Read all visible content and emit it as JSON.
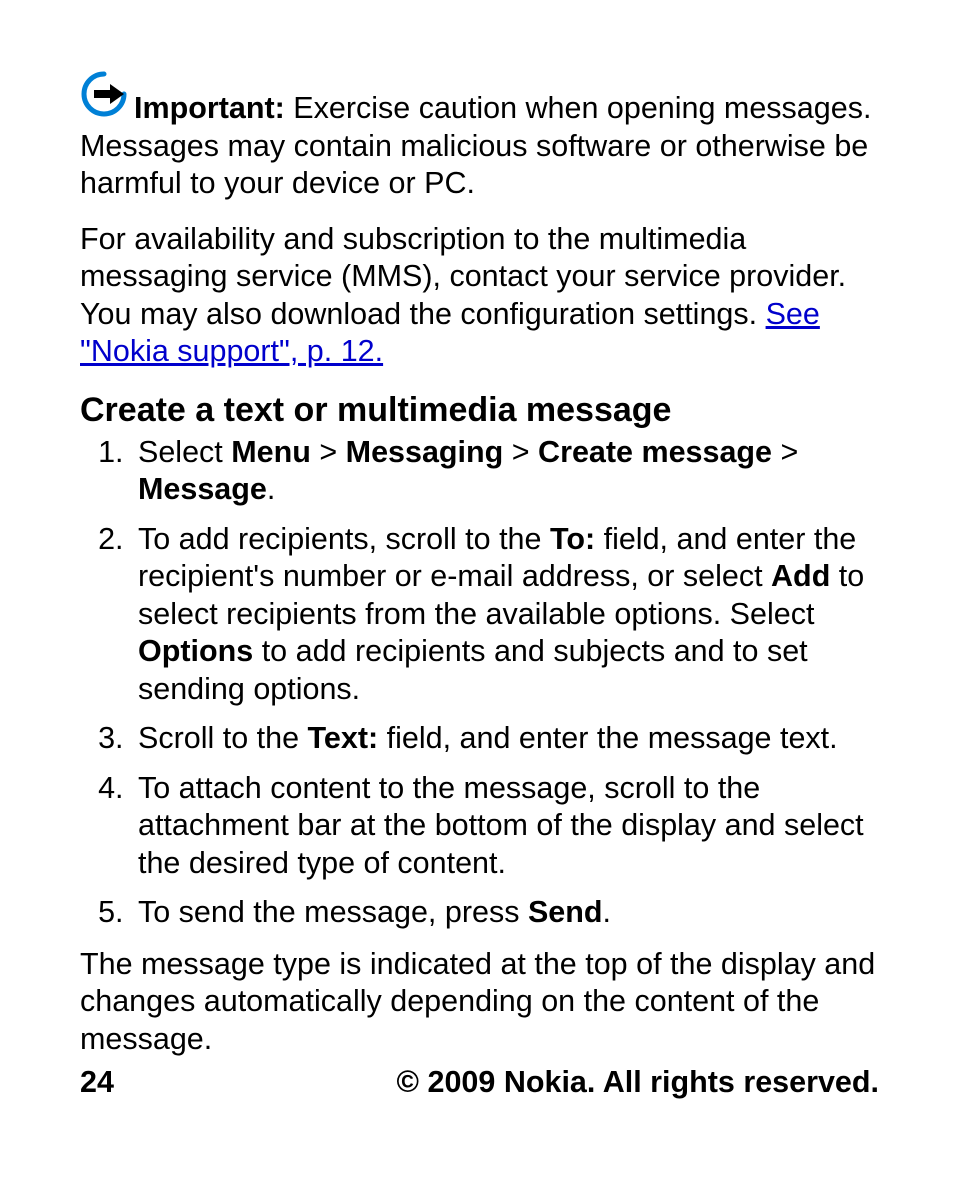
{
  "important": {
    "label": "Important:",
    "text": "  Exercise caution when opening messages. Messages may contain malicious software or otherwise be harmful to your device or PC."
  },
  "availability": {
    "pre": "For availability and subscription to the multimedia messaging service (MMS), contact your service provider. You may also download the configuration settings. ",
    "link": "See \"Nokia support\", p. 12."
  },
  "heading": "Create a text or multimedia message",
  "steps": {
    "s1": {
      "pre": "Select ",
      "b1": "Menu",
      "sep": " > ",
      "b2": "Messaging",
      "b3": "Create message",
      "b4": "Message",
      "end": "."
    },
    "s2": {
      "pre": "To add recipients, scroll to the ",
      "b1": "To:",
      "mid1": " field, and enter the recipient's number or e-mail address, or select ",
      "b2": "Add",
      "mid2": " to select recipients from the available options. Select ",
      "b3": "Options",
      "end": " to add recipients and subjects and to set sending options."
    },
    "s3": {
      "pre": "Scroll to the ",
      "b1": "Text:",
      "end": " field, and enter the message text."
    },
    "s4": {
      "text": "To attach content to the message, scroll to the attachment bar at the bottom of the display and select the desired type of content."
    },
    "s5": {
      "pre": "To send the message, press ",
      "b1": "Send",
      "end": "."
    }
  },
  "closing": "The message type is indicated at the top of the display and changes automatically depending on the content of the message.",
  "footer": {
    "page": "24",
    "copyright": "© 2009 Nokia. All rights reserved."
  },
  "colors": {
    "link": "#0000cc",
    "icon_stroke": "#0080d6",
    "icon_fill": "#000000"
  }
}
